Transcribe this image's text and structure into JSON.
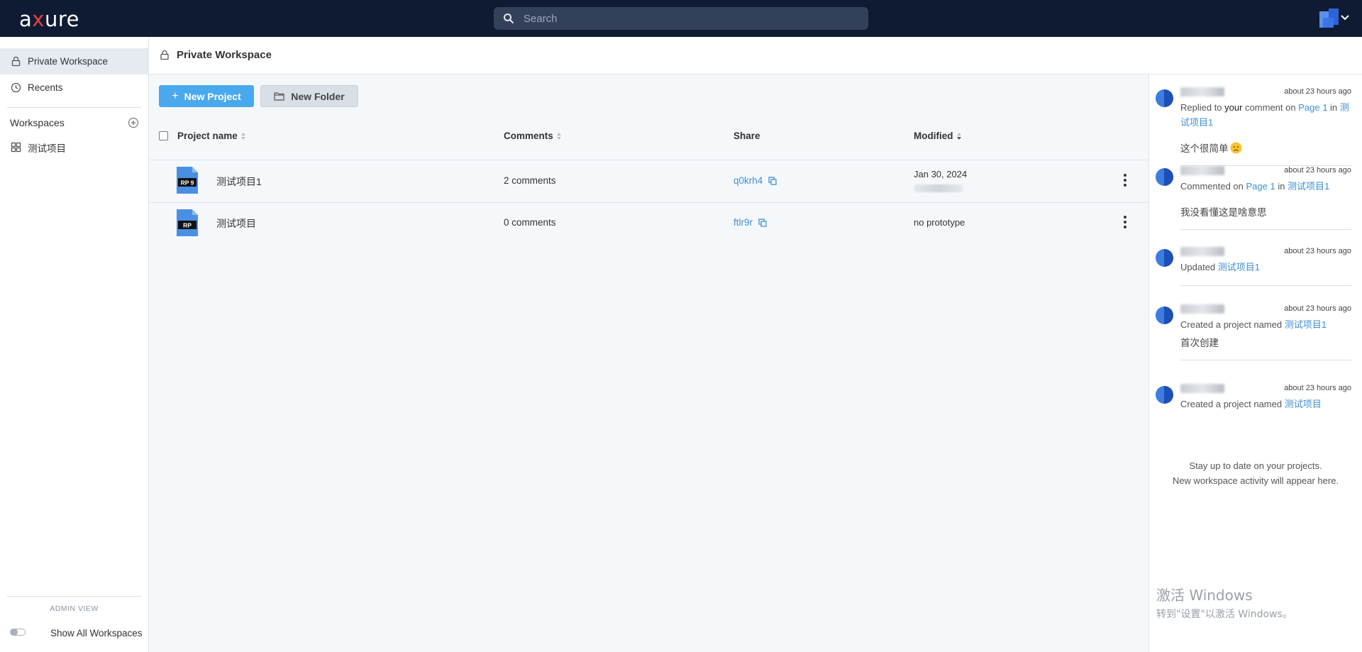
{
  "app": {
    "logo_pre": "a",
    "logo_x": "x",
    "logo_post": "ure"
  },
  "search": {
    "placeholder": "Search"
  },
  "sidebar": {
    "items": [
      {
        "label": "Private Workspace",
        "icon": "lock-icon"
      },
      {
        "label": "Recents",
        "icon": "clock-icon"
      }
    ],
    "workspaces_label": "Workspaces",
    "workspace_items": [
      {
        "label": "测试项目",
        "icon": "grid-icon"
      }
    ],
    "admin_view_label": "ADMIN VIEW",
    "show_all_label": "Show All Workspaces"
  },
  "header": {
    "title": "Private Workspace"
  },
  "toolbar": {
    "new_project": "New Project",
    "new_folder": "New Folder"
  },
  "table": {
    "columns": {
      "name": "Project name",
      "comments": "Comments",
      "share": "Share",
      "modified": "Modified"
    },
    "rows": [
      {
        "badge": "RP 9",
        "name": "测试项目1",
        "comments": "2 comments",
        "share": "q0krh4",
        "modified": "Jan 30, 2024"
      },
      {
        "badge": "RP",
        "name": "测试项目",
        "comments": "0 comments",
        "share": "ftlr9r",
        "modified": "no prototype"
      }
    ]
  },
  "activity": {
    "items": [
      {
        "time": "about 23 hours ago",
        "t1": "Replied to ",
        "t2": "your",
        "t3": " comment on ",
        "link1": "Page 1",
        "t4": " in ",
        "link2": "测试项目1",
        "quote": "这个很简单"
      },
      {
        "time": "about 23 hours ago",
        "t1": "Commented on ",
        "link1": "Page 1",
        "t2": " in ",
        "link2": "测试项目1",
        "quote": "我没看懂这是啥意思"
      },
      {
        "time": "about 23 hours ago",
        "t1": "Updated ",
        "link1": "测试项目1"
      },
      {
        "time": "about 23 hours ago",
        "t1": "Created a project named ",
        "link1": "测试项目1",
        "quote": "首次创建"
      },
      {
        "time": "about 23 hours ago",
        "t1": "Created a project named ",
        "link1": "测试项目"
      }
    ],
    "footer_line1": "Stay up to date on your projects.",
    "footer_line2": "New workspace activity will appear here."
  },
  "watermark": {
    "line1": "激活 Windows",
    "line2": "转到\"设置\"以激活 Windows。"
  },
  "colors": {
    "topbar": "#0f1b33",
    "accent": "#4aa9ec",
    "link": "#3f8fd2",
    "logo_x": "#e8413c"
  }
}
